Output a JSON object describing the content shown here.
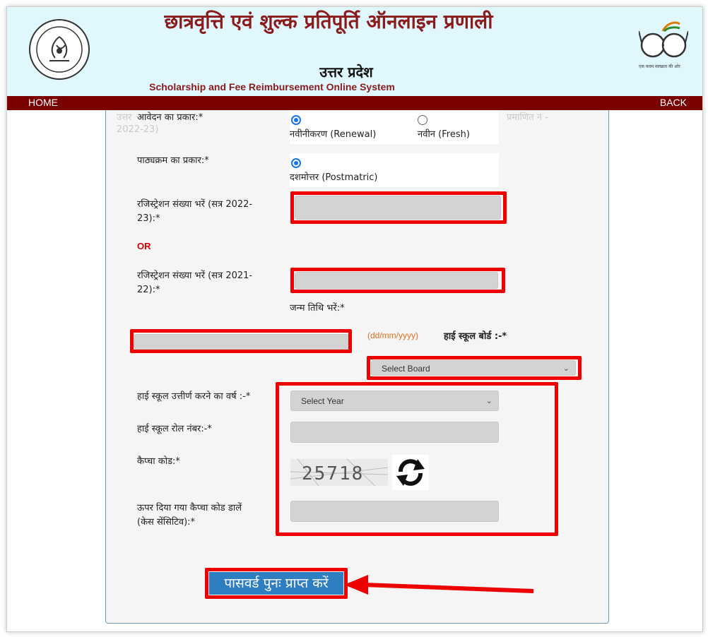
{
  "header": {
    "title_hindi": "छात्रवृत्ति एवं शुल्क प्रतिपूर्ति ऑनलाइन प्रणाली",
    "state_hindi": "उत्तर प्रदेश",
    "title_english": "Scholarship and Fee Reimbursement Online System",
    "emblem_text": "उत्तर प्रदेश सरकार",
    "swachh_text": "स्वच्छ भारत",
    "swachh_tagline": "एक कदम स्वच्छता की ओर"
  },
  "nav": {
    "home": "HOME",
    "back": "BACK"
  },
  "ghost_text": {
    "left": "उत्तर",
    "right": "प्रमाणित नं -",
    "year": "2022-23)"
  },
  "form": {
    "application_type_label": "आवेदन का प्रकार:*",
    "renewal_label": "नवीनीकरण (Renewal)",
    "fresh_label": "नवीन (Fresh)",
    "course_type_label": "पाठ्यक्रम का प्रकार:*",
    "postmatric_label": "दशमोत्तर (Postmatric)",
    "reg_2022_label_1": "रजिस्ट्रेशन संख्या भरें (सत्र 2022-",
    "reg_2022_label_2": "23):*",
    "or_label": "OR",
    "reg_2021_label_1": "रजिस्ट्रेशन संख्या भरें (सत्र 2021-",
    "reg_2021_label_2": "22):*",
    "dob_label": "जन्म तिथि भरें:*",
    "dob_format": "(dd/mm/yyyy)",
    "board_label": "हाई स्कूल बोर्ड :-*",
    "board_select": "Select Board",
    "hs_year_label": "हाई स्कूल उत्तीर्ण करने का वर्ष :-*",
    "year_select": "Select Year",
    "hs_roll_label": "हाई स्कूल रोल नंबर:-*",
    "captcha_label": "कैप्चा कोड:*",
    "captcha_value": "25718",
    "captcha_input_label_1": "ऊपर दिया गया कैप्चा कोड डालें",
    "captcha_input_label_2": "(केस सेंसिटिव):*",
    "submit_label": "पासवर्ड पुनः प्राप्त करें"
  },
  "colors": {
    "header_bg": "#dff7fd",
    "title_maroon": "#8b1a1a",
    "nav_bg": "#7a0000",
    "highlight_red": "#ee0000",
    "button_blue": "#2f7fc0",
    "field_gray": "#d3d3d3"
  }
}
